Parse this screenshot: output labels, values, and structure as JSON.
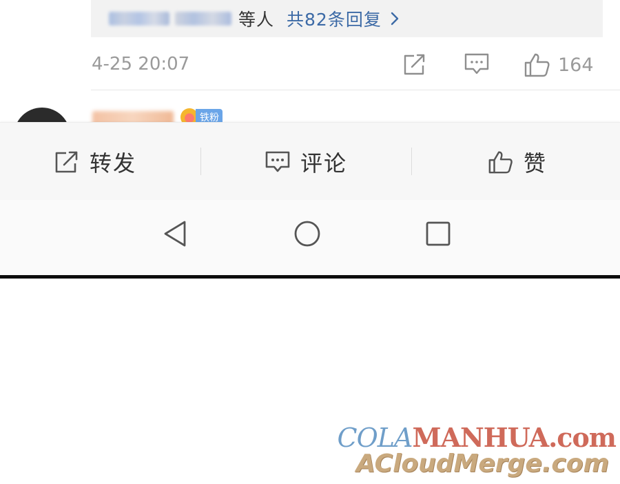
{
  "reply_summary": {
    "suffix": "等人",
    "total_replies": "共82条回复"
  },
  "comment_meta": {
    "timestamp": "4-25 20:07",
    "like_count": "164"
  },
  "next_comment": {
    "badge": "铁粉"
  },
  "action_bar": {
    "repost_label": "转发",
    "comment_label": "评论",
    "like_label": "赞"
  },
  "watermark": {
    "line1_a": "COLA",
    "line1_b": "MANHUA.com",
    "line2": "ACloudMerge.com"
  },
  "icons": {
    "repost": "share-out-icon",
    "comment": "comment-bubble-icon",
    "like": "thumbs-up-icon",
    "chevron": "chevron-right-icon",
    "nav_back": "triangle-back-icon",
    "nav_home": "circle-home-icon",
    "nav_recent": "square-recent-icon"
  },
  "colors": {
    "link": "#3c6aa6",
    "muted": "#9a9a9a",
    "bar_bg": "#f7f7f7"
  }
}
